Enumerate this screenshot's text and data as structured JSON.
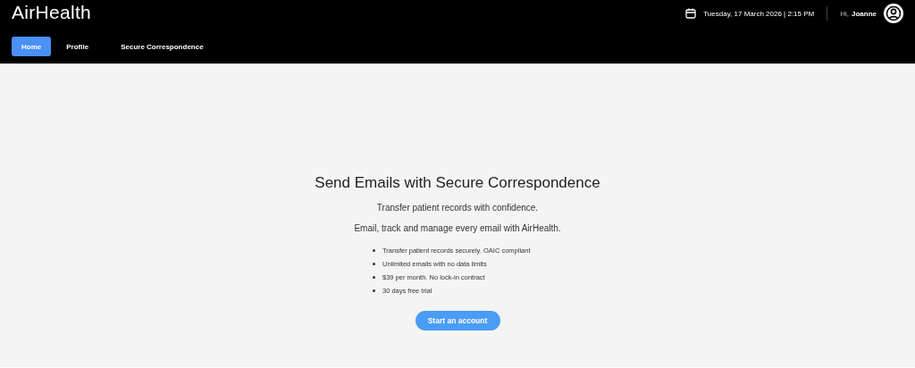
{
  "header": {
    "logo": "AirHealth",
    "datetime": "Tuesday, 17 March 2026 | 2:15 PM",
    "greeting": "Hi,",
    "user_name": "Joanne"
  },
  "nav": [
    {
      "label": "Home",
      "selected": true
    },
    {
      "label": "Profile",
      "selected": false
    },
    {
      "label": "Secure Correspondence",
      "selected": false
    }
  ],
  "main": {
    "title": "Send Emails with Secure Correspondence",
    "lines": [
      "Transfer patient records with confidence.",
      "Email, track and manage every email with AirHealth."
    ],
    "features": [
      "Transfer patient records securely. OAIC compliant",
      "Unlimited emails with no data limits",
      "$39 per month. No lock-in contract",
      "30 days free trial"
    ],
    "button": "Start an account"
  }
}
